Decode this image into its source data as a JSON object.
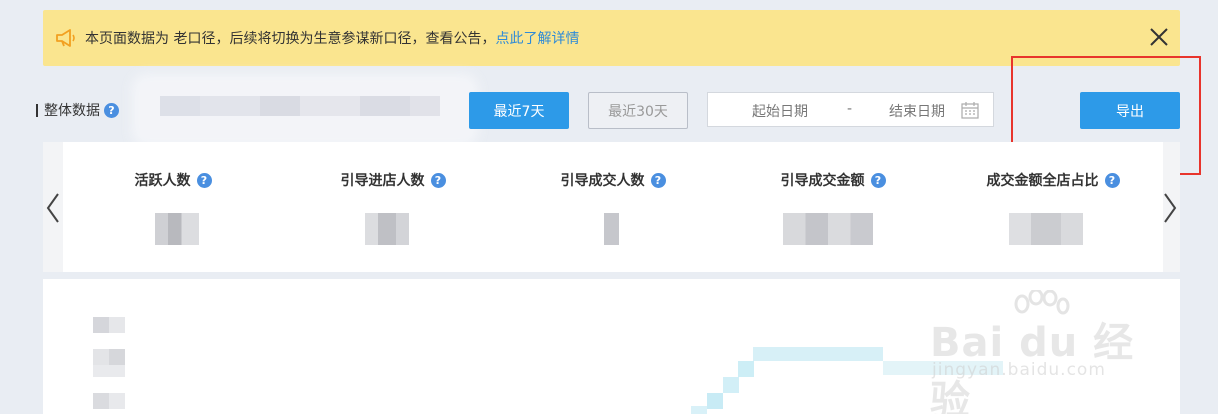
{
  "notice": {
    "text": "本页面数据为 老口径，后续将切换为生意参谋新口径，查看公告，",
    "link": "点此了解详情",
    "colors": {
      "background": "#fae58f",
      "link": "#2e8bd8",
      "horn": "#f2a020"
    }
  },
  "toolbar": {
    "section_label": "整体数据",
    "help_glyph": "?",
    "range_7": "最近7天",
    "range_30": "最近30天",
    "date_start": "起始日期",
    "date_sep": "-",
    "date_end": "结束日期",
    "export": "导出"
  },
  "metrics": [
    {
      "label": "活跃人数"
    },
    {
      "label": "引导进店人数"
    },
    {
      "label": "引导成交人数"
    },
    {
      "label": "引导成交金额"
    },
    {
      "label": "成交金额全店占比"
    }
  ],
  "watermark": {
    "brand": "Bai du 经验",
    "url": "jingyan.baidu.com"
  },
  "colors": {
    "primary": "#2d9ae8",
    "highlight_box": "#e8342c",
    "page_bg": "#e9edf3"
  },
  "icons": [
    "horn-icon",
    "close-icon",
    "help-icon",
    "calendar-icon",
    "chevron-left-icon",
    "chevron-right-icon"
  ]
}
